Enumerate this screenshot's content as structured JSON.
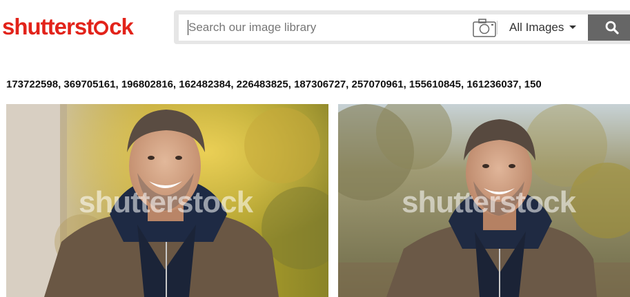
{
  "brand": {
    "logo_prefix": "shutterst",
    "logo_suffix": "ck",
    "color": "#e2231a"
  },
  "search": {
    "placeholder": "Search our image library",
    "filter_label": "All Images",
    "filter_icon": "chevron-down-icon",
    "camera_icon": "camera-icon",
    "search_icon": "magnifier-icon"
  },
  "results": {
    "id_list": "173722598, 369705161, 196802816, 162482384, 226483825, 187306727, 257070961, 155610845, 161236037, 150",
    "images": [
      {
        "watermark_prefix": "shutterst",
        "watermark_suffix": "ck"
      },
      {
        "watermark_prefix": "shutterst",
        "watermark_suffix": "ck"
      }
    ]
  }
}
